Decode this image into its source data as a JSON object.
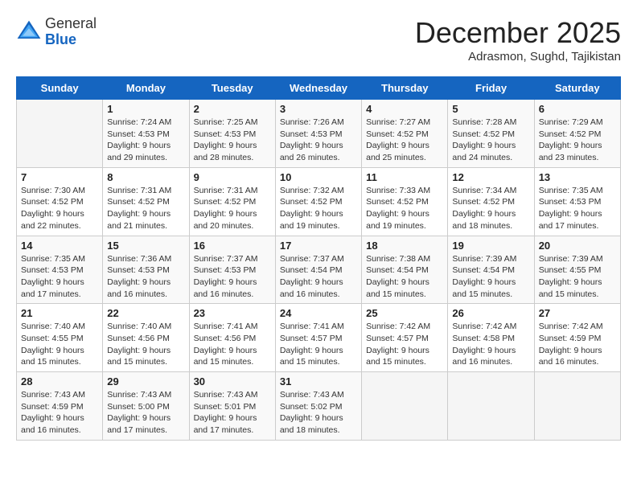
{
  "header": {
    "logo_line1": "General",
    "logo_line2": "Blue",
    "month_title": "December 2025",
    "subtitle": "Adrasmon, Sughd, Tajikistan"
  },
  "days_of_week": [
    "Sunday",
    "Monday",
    "Tuesday",
    "Wednesday",
    "Thursday",
    "Friday",
    "Saturday"
  ],
  "weeks": [
    [
      {
        "day": "",
        "sunrise": "",
        "sunset": "",
        "daylight": ""
      },
      {
        "day": "1",
        "sunrise": "Sunrise: 7:24 AM",
        "sunset": "Sunset: 4:53 PM",
        "daylight": "Daylight: 9 hours and 29 minutes."
      },
      {
        "day": "2",
        "sunrise": "Sunrise: 7:25 AM",
        "sunset": "Sunset: 4:53 PM",
        "daylight": "Daylight: 9 hours and 28 minutes."
      },
      {
        "day": "3",
        "sunrise": "Sunrise: 7:26 AM",
        "sunset": "Sunset: 4:53 PM",
        "daylight": "Daylight: 9 hours and 26 minutes."
      },
      {
        "day": "4",
        "sunrise": "Sunrise: 7:27 AM",
        "sunset": "Sunset: 4:52 PM",
        "daylight": "Daylight: 9 hours and 25 minutes."
      },
      {
        "day": "5",
        "sunrise": "Sunrise: 7:28 AM",
        "sunset": "Sunset: 4:52 PM",
        "daylight": "Daylight: 9 hours and 24 minutes."
      },
      {
        "day": "6",
        "sunrise": "Sunrise: 7:29 AM",
        "sunset": "Sunset: 4:52 PM",
        "daylight": "Daylight: 9 hours and 23 minutes."
      }
    ],
    [
      {
        "day": "7",
        "sunrise": "Sunrise: 7:30 AM",
        "sunset": "Sunset: 4:52 PM",
        "daylight": "Daylight: 9 hours and 22 minutes."
      },
      {
        "day": "8",
        "sunrise": "Sunrise: 7:31 AM",
        "sunset": "Sunset: 4:52 PM",
        "daylight": "Daylight: 9 hours and 21 minutes."
      },
      {
        "day": "9",
        "sunrise": "Sunrise: 7:31 AM",
        "sunset": "Sunset: 4:52 PM",
        "daylight": "Daylight: 9 hours and 20 minutes."
      },
      {
        "day": "10",
        "sunrise": "Sunrise: 7:32 AM",
        "sunset": "Sunset: 4:52 PM",
        "daylight": "Daylight: 9 hours and 19 minutes."
      },
      {
        "day": "11",
        "sunrise": "Sunrise: 7:33 AM",
        "sunset": "Sunset: 4:52 PM",
        "daylight": "Daylight: 9 hours and 19 minutes."
      },
      {
        "day": "12",
        "sunrise": "Sunrise: 7:34 AM",
        "sunset": "Sunset: 4:52 PM",
        "daylight": "Daylight: 9 hours and 18 minutes."
      },
      {
        "day": "13",
        "sunrise": "Sunrise: 7:35 AM",
        "sunset": "Sunset: 4:53 PM",
        "daylight": "Daylight: 9 hours and 17 minutes."
      }
    ],
    [
      {
        "day": "14",
        "sunrise": "Sunrise: 7:35 AM",
        "sunset": "Sunset: 4:53 PM",
        "daylight": "Daylight: 9 hours and 17 minutes."
      },
      {
        "day": "15",
        "sunrise": "Sunrise: 7:36 AM",
        "sunset": "Sunset: 4:53 PM",
        "daylight": "Daylight: 9 hours and 16 minutes."
      },
      {
        "day": "16",
        "sunrise": "Sunrise: 7:37 AM",
        "sunset": "Sunset: 4:53 PM",
        "daylight": "Daylight: 9 hours and 16 minutes."
      },
      {
        "day": "17",
        "sunrise": "Sunrise: 7:37 AM",
        "sunset": "Sunset: 4:54 PM",
        "daylight": "Daylight: 9 hours and 16 minutes."
      },
      {
        "day": "18",
        "sunrise": "Sunrise: 7:38 AM",
        "sunset": "Sunset: 4:54 PM",
        "daylight": "Daylight: 9 hours and 15 minutes."
      },
      {
        "day": "19",
        "sunrise": "Sunrise: 7:39 AM",
        "sunset": "Sunset: 4:54 PM",
        "daylight": "Daylight: 9 hours and 15 minutes."
      },
      {
        "day": "20",
        "sunrise": "Sunrise: 7:39 AM",
        "sunset": "Sunset: 4:55 PM",
        "daylight": "Daylight: 9 hours and 15 minutes."
      }
    ],
    [
      {
        "day": "21",
        "sunrise": "Sunrise: 7:40 AM",
        "sunset": "Sunset: 4:55 PM",
        "daylight": "Daylight: 9 hours and 15 minutes."
      },
      {
        "day": "22",
        "sunrise": "Sunrise: 7:40 AM",
        "sunset": "Sunset: 4:56 PM",
        "daylight": "Daylight: 9 hours and 15 minutes."
      },
      {
        "day": "23",
        "sunrise": "Sunrise: 7:41 AM",
        "sunset": "Sunset: 4:56 PM",
        "daylight": "Daylight: 9 hours and 15 minutes."
      },
      {
        "day": "24",
        "sunrise": "Sunrise: 7:41 AM",
        "sunset": "Sunset: 4:57 PM",
        "daylight": "Daylight: 9 hours and 15 minutes."
      },
      {
        "day": "25",
        "sunrise": "Sunrise: 7:42 AM",
        "sunset": "Sunset: 4:57 PM",
        "daylight": "Daylight: 9 hours and 15 minutes."
      },
      {
        "day": "26",
        "sunrise": "Sunrise: 7:42 AM",
        "sunset": "Sunset: 4:58 PM",
        "daylight": "Daylight: 9 hours and 16 minutes."
      },
      {
        "day": "27",
        "sunrise": "Sunrise: 7:42 AM",
        "sunset": "Sunset: 4:59 PM",
        "daylight": "Daylight: 9 hours and 16 minutes."
      }
    ],
    [
      {
        "day": "28",
        "sunrise": "Sunrise: 7:43 AM",
        "sunset": "Sunset: 4:59 PM",
        "daylight": "Daylight: 9 hours and 16 minutes."
      },
      {
        "day": "29",
        "sunrise": "Sunrise: 7:43 AM",
        "sunset": "Sunset: 5:00 PM",
        "daylight": "Daylight: 9 hours and 17 minutes."
      },
      {
        "day": "30",
        "sunrise": "Sunrise: 7:43 AM",
        "sunset": "Sunset: 5:01 PM",
        "daylight": "Daylight: 9 hours and 17 minutes."
      },
      {
        "day": "31",
        "sunrise": "Sunrise: 7:43 AM",
        "sunset": "Sunset: 5:02 PM",
        "daylight": "Daylight: 9 hours and 18 minutes."
      },
      {
        "day": "",
        "sunrise": "",
        "sunset": "",
        "daylight": ""
      },
      {
        "day": "",
        "sunrise": "",
        "sunset": "",
        "daylight": ""
      },
      {
        "day": "",
        "sunrise": "",
        "sunset": "",
        "daylight": ""
      }
    ]
  ]
}
